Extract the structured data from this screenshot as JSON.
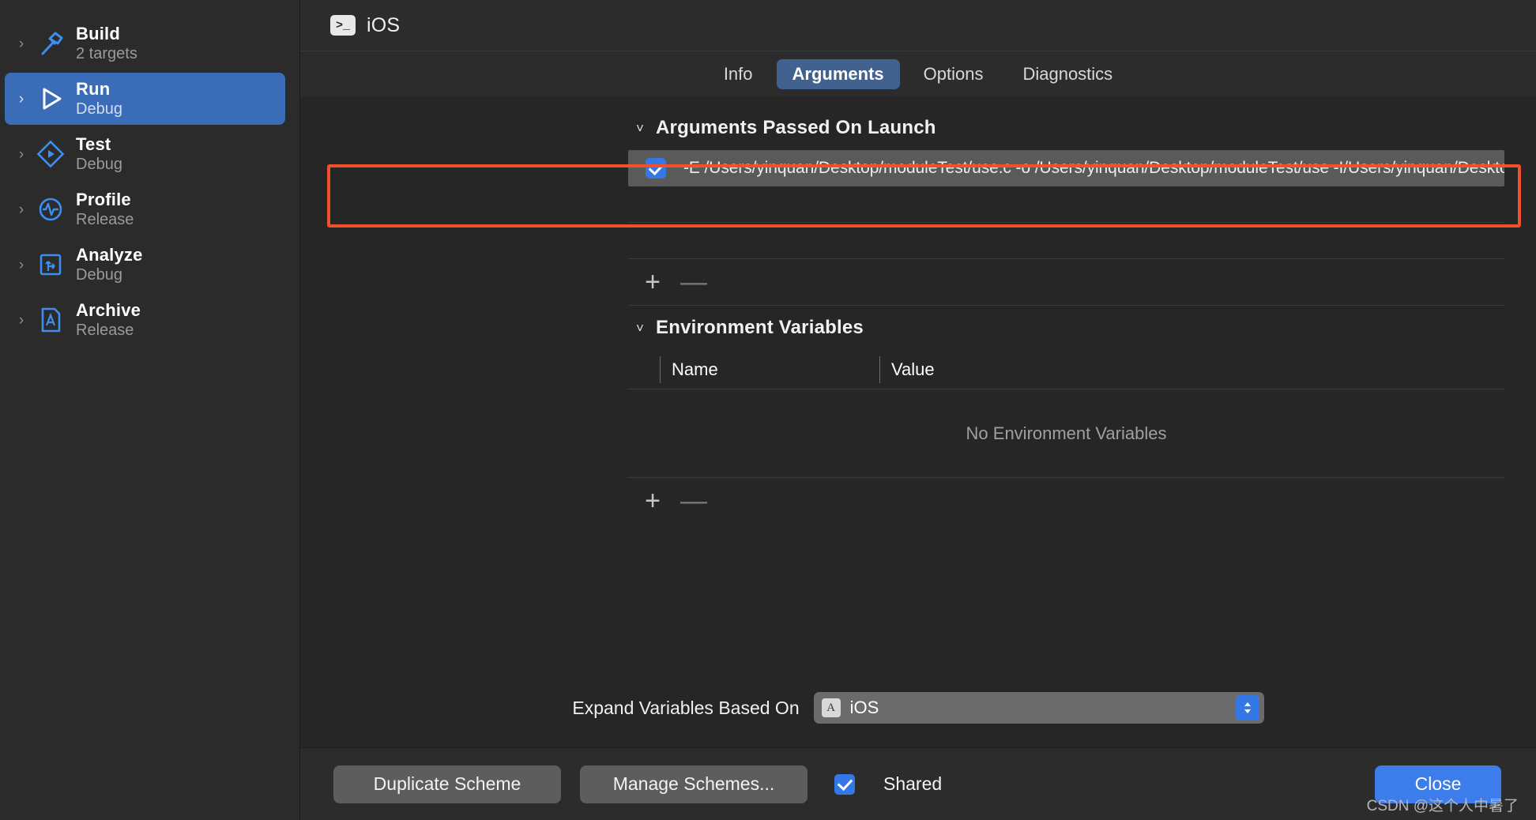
{
  "sidebar": {
    "items": [
      {
        "title": "Build",
        "subtitle": "2 targets",
        "icon": "hammer-icon",
        "selected": false
      },
      {
        "title": "Run",
        "subtitle": "Debug",
        "icon": "play-icon",
        "selected": true
      },
      {
        "title": "Test",
        "subtitle": "Debug",
        "icon": "diamond-play-icon",
        "selected": false
      },
      {
        "title": "Profile",
        "subtitle": "Release",
        "icon": "gauge-icon",
        "selected": false
      },
      {
        "title": "Analyze",
        "subtitle": "Debug",
        "icon": "analyze-icon",
        "selected": false
      },
      {
        "title": "Archive",
        "subtitle": "Release",
        "icon": "archive-icon",
        "selected": false
      }
    ]
  },
  "titlebar": {
    "scheme_name": "iOS",
    "icon": "terminal-icon",
    "icon_glyph": ">_"
  },
  "tabs": [
    {
      "label": "Info",
      "active": false
    },
    {
      "label": "Arguments",
      "active": true
    },
    {
      "label": "Options",
      "active": false
    },
    {
      "label": "Diagnostics",
      "active": false
    }
  ],
  "arguments_section": {
    "title": "Arguments Passed On Launch",
    "collapsed": false,
    "rows": [
      {
        "checked": true,
        "text": "-E /Users/yinquan/Desktop/moduleTest/use.c -o /Users/yinquan/Desktop/moduleTest/use -I/Users/yinquan/Desktop/ -fmodules -f"
      }
    ],
    "add_label": "+",
    "remove_label": "—"
  },
  "environment_section": {
    "title": "Environment Variables",
    "collapsed": false,
    "columns": [
      "Name",
      "Value"
    ],
    "rows": [],
    "empty_text": "No Environment Variables",
    "add_label": "+",
    "remove_label": "—"
  },
  "expand_variables": {
    "label": "Expand Variables Based On",
    "value": "iOS",
    "icon": "app-icon"
  },
  "footer": {
    "duplicate_label": "Duplicate Scheme",
    "manage_label": "Manage Schemes...",
    "shared_label": "Shared",
    "shared_checked": true,
    "close_label": "Close"
  },
  "watermark": "CSDN @这个人中暑了",
  "colors": {
    "accent_blue": "#3478e8",
    "selection_blue": "#3a6cb8",
    "tab_active_blue": "#41618f",
    "close_button_blue": "#3c7ceb",
    "highlight_orange": "#f0502d",
    "panel_bg": "#262626",
    "sidebar_bg": "#2b2b2b",
    "row_bg": "#5a5a5a"
  }
}
